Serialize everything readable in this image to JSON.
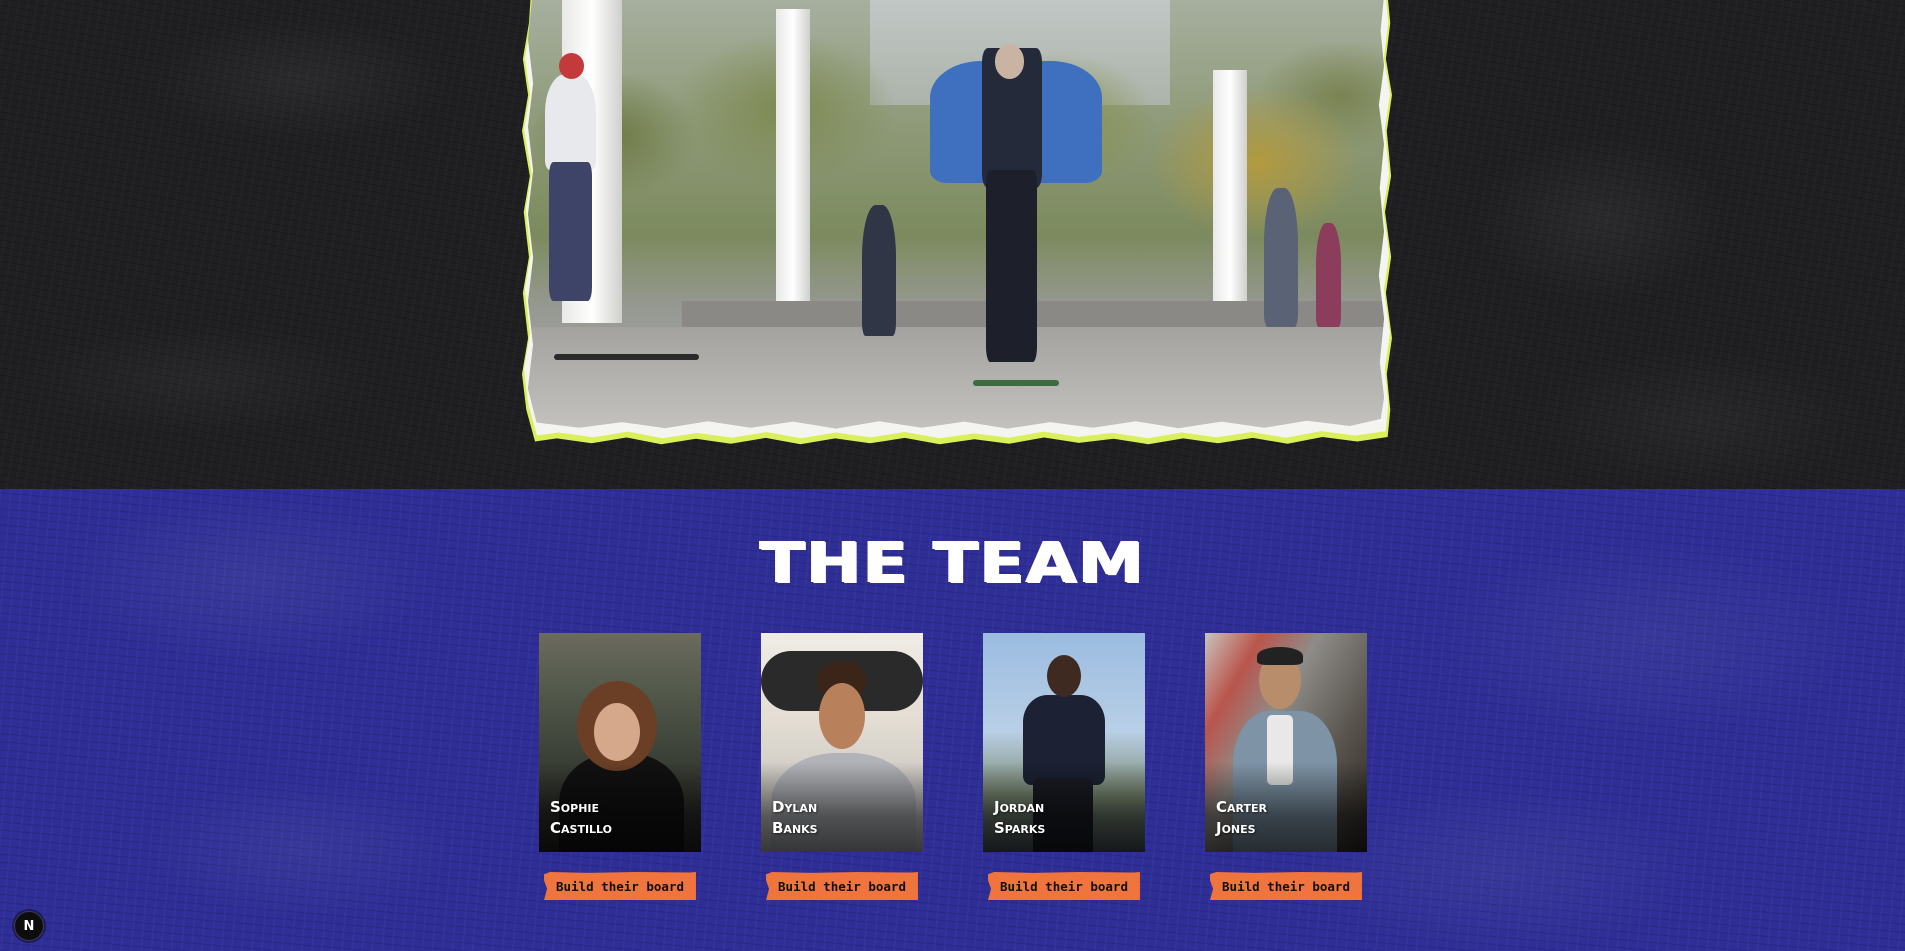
{
  "hero": {
    "image_alt": "Skateboarders in a park plaza",
    "frame_color": "#d9f05a"
  },
  "team": {
    "title": "THE TEAM",
    "background_color": "#2e2e96",
    "members": [
      {
        "first": "Sophie",
        "last": "Castillo",
        "button_label": "Build their board"
      },
      {
        "first": "Dylan",
        "last": "Banks",
        "button_label": "Build their board"
      },
      {
        "first": "Jordan",
        "last": "Sparks",
        "button_label": "Build their board"
      },
      {
        "first": "Carter",
        "last": "Jones",
        "button_label": "Build their board"
      }
    ],
    "button_color": "#f0743d"
  },
  "dev_badge": {
    "label": "N",
    "icon": "nextjs-icon"
  }
}
